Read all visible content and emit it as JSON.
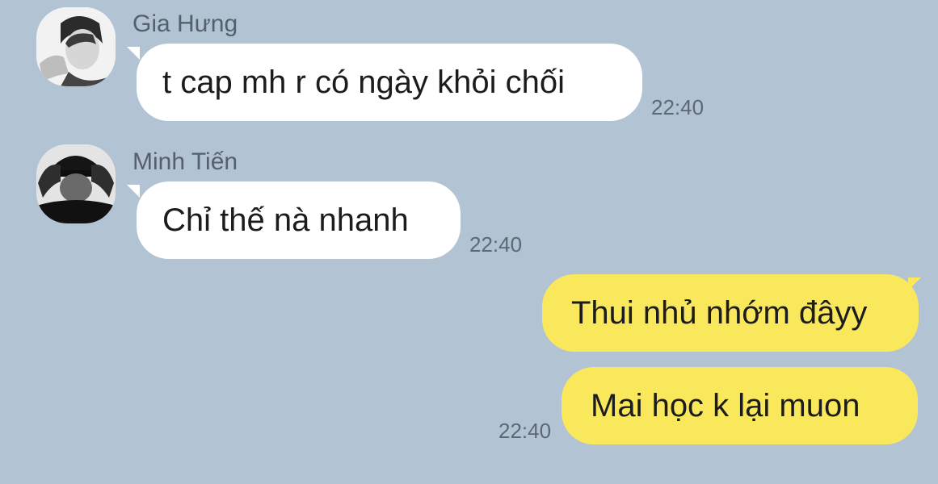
{
  "chat": {
    "messages": [
      {
        "sender": "Gia Hưng",
        "text": "t cap mh r có ngày khỏi chối",
        "time": "22:40",
        "direction": "incoming"
      },
      {
        "sender": "Minh Tiến",
        "text": "Chỉ thế nà nhanh",
        "time": "22:40",
        "direction": "incoming"
      },
      {
        "text": "Thui nhủ nhớm đâyy",
        "direction": "outgoing"
      },
      {
        "text": "Mai học k lại muon",
        "time": "22:40",
        "direction": "outgoing"
      }
    ]
  },
  "colors": {
    "background": "#b2c3d4",
    "incoming_bubble": "#ffffff",
    "outgoing_bubble": "#fae85c",
    "timestamp": "#5d6874",
    "sender_name": "#56606b"
  },
  "icons": {
    "avatar_1": "avatar-photo-icon",
    "avatar_2": "avatar-photo-icon"
  }
}
